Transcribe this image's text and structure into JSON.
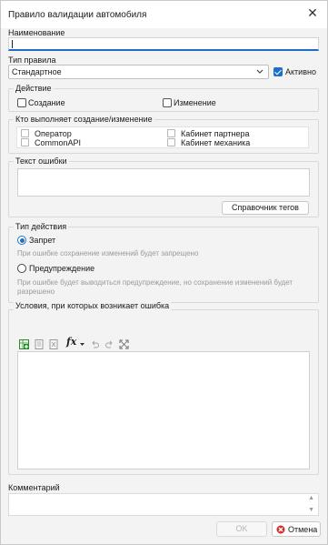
{
  "window": {
    "title": "Правило валидации автомобиля",
    "close_icon": "close-icon"
  },
  "name": {
    "label": "Наименование",
    "value": ""
  },
  "rule_type": {
    "label": "Тип правила",
    "selected": "Стандартное",
    "active_label": "Активно",
    "active_checked": true
  },
  "action": {
    "legend": "Действие",
    "create_label": "Создание",
    "create_checked": false,
    "change_label": "Изменение",
    "change_checked": false
  },
  "who": {
    "legend": "Кто выполняет создание/изменение",
    "items": [
      {
        "label": "Оператор",
        "checked": false
      },
      {
        "label": "CommonAPI",
        "checked": false
      },
      {
        "label": "Кабинет партнера",
        "checked": false
      },
      {
        "label": "Кабинет механика",
        "checked": false
      }
    ]
  },
  "error_text": {
    "legend": "Текст ошибки",
    "value": "",
    "tags_button": "Справочник тегов"
  },
  "action_type": {
    "legend": "Тип действия",
    "ban_label": "Запрет",
    "ban_hint": "При ошибке сохранение изменений будет запрещено",
    "warn_label": "Предупреждение",
    "warn_hint_line1": "При ошибке будет выводиться предупреждение, но сохранение изменений будет",
    "warn_hint_line2": "разрешено",
    "selected": "ban"
  },
  "conditions": {
    "legend": "Условия, при которых возникает ошибка",
    "toolbar": [
      "add-condition-icon",
      "edit-icon",
      "delete-icon",
      "fx-function-icon",
      "undo-icon",
      "redo-icon",
      "expand-icon"
    ],
    "fx_label": "fx"
  },
  "comment": {
    "label": "Комментарий",
    "value": ""
  },
  "footer": {
    "ok_label": "OK",
    "cancel_label": "Отмена"
  }
}
